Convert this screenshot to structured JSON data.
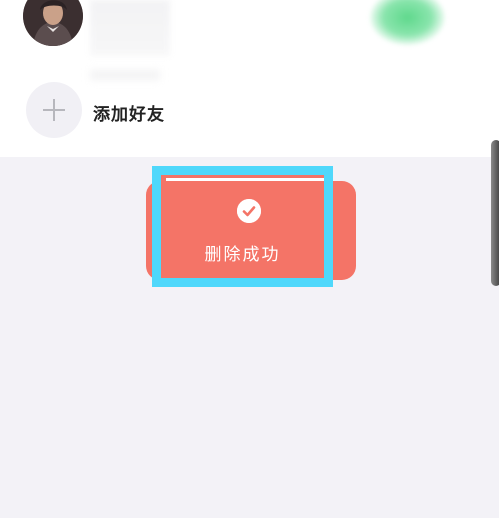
{
  "contacts": {
    "add_friend_label": "添加好友"
  },
  "toast": {
    "message": "删除成功",
    "icon": "check-circle-icon"
  },
  "colors": {
    "background": "#f3f2f7",
    "toast_fill": "#f47467",
    "highlight_border": "#4fd8fb",
    "online_green": "#5fd88c"
  }
}
